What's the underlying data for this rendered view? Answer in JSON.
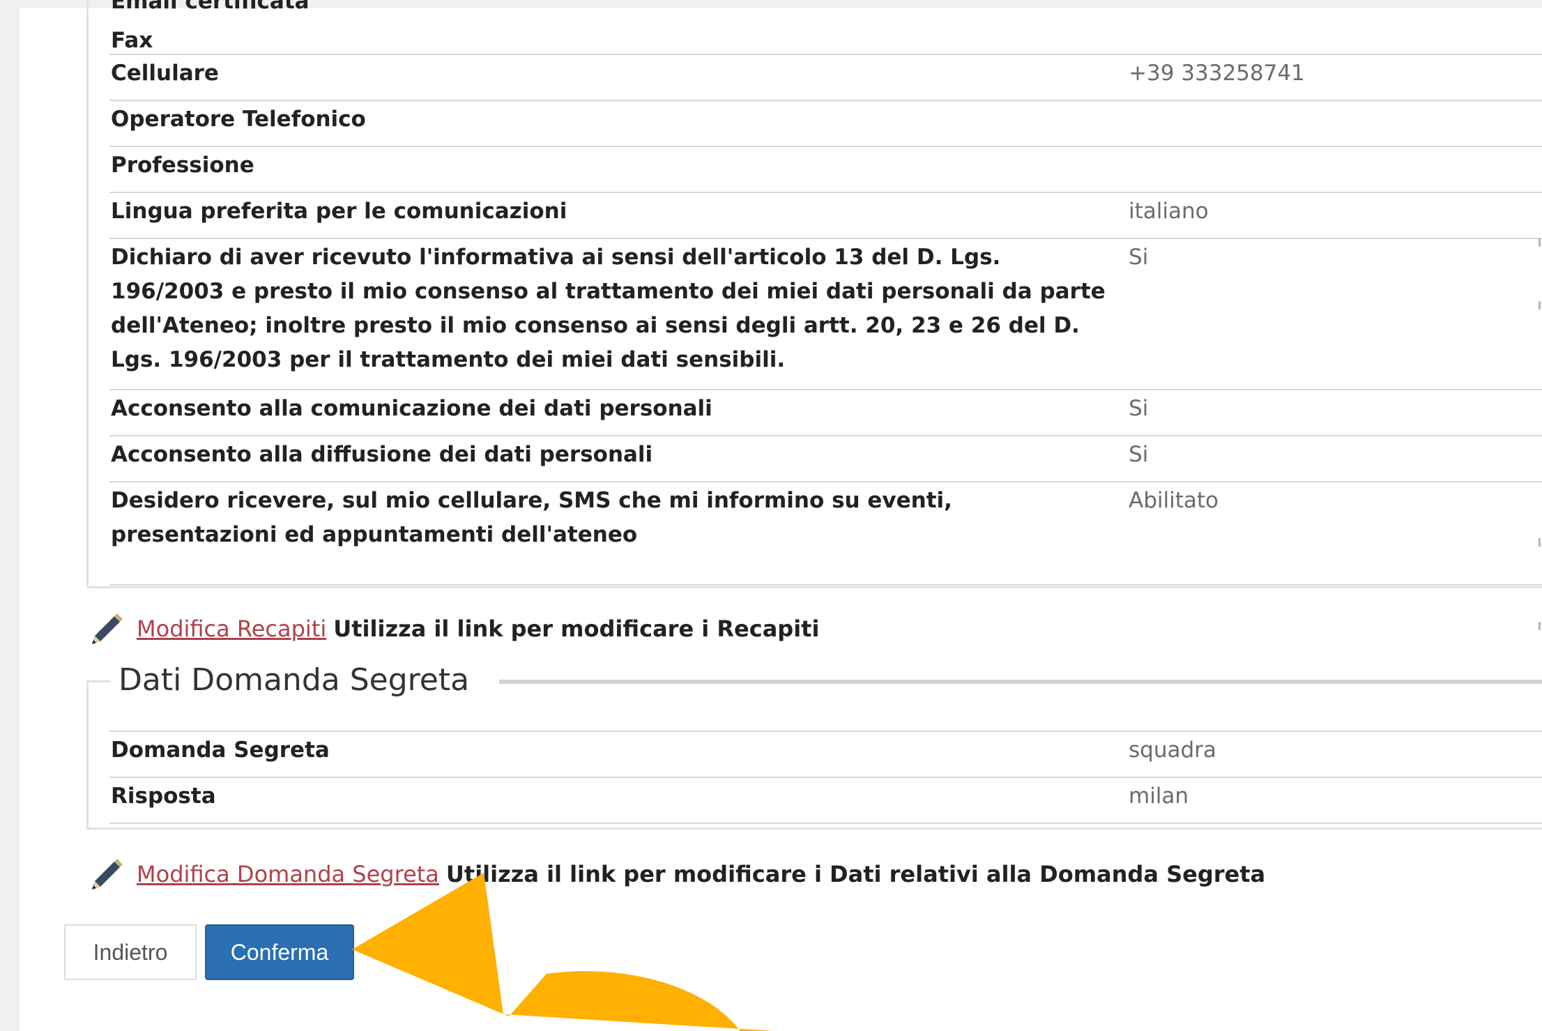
{
  "contacts": {
    "cut_label": "Email certificata",
    "rows": [
      {
        "label": "Fax",
        "value": ""
      },
      {
        "label": "Cellulare",
        "value": "+39 333258741"
      },
      {
        "label": "Operatore Telefonico",
        "value": ""
      },
      {
        "label": "Professione",
        "value": ""
      },
      {
        "label": "Lingua preferita per le comunicazioni",
        "value": "italiano"
      },
      {
        "label": "Dichiaro di aver ricevuto l'informativa ai sensi dell'articolo 13 del D. Lgs. 196/2003 e presto il mio consenso al trattamento dei miei dati personali da parte dell'Ateneo; inoltre presto il mio consenso ai sensi degli artt. 20, 23 e 26 del D. Lgs. 196/2003 per il trattamento dei miei dati sensibili.",
        "value": "Si"
      },
      {
        "label": "Acconsento alla comunicazione dei dati personali",
        "value": "Si"
      },
      {
        "label": "Acconsento alla diffusione dei dati personali",
        "value": "Si"
      },
      {
        "label": "Desidero ricevere, sul mio cellulare, SMS che mi informino su eventi, presentazioni ed appuntamenti dell'ateneo",
        "value": "Abilitato"
      }
    ],
    "edit_link": "Modifica Recapiti",
    "edit_text": "Utilizza il link per modificare i Recapiti",
    "edit_icon": "pencil-icon"
  },
  "secret": {
    "title": "Dati Domanda Segreta",
    "rows": [
      {
        "label": "Domanda Segreta",
        "value": "squadra"
      },
      {
        "label": "Risposta",
        "value": "milan"
      }
    ],
    "edit_link": "Modifica Domanda Segreta",
    "edit_text": "Utilizza il link per modificare i Dati relativi alla Domanda Segreta",
    "edit_icon": "pencil-icon"
  },
  "actions": {
    "back_label": "Indietro",
    "confirm_label": "Conferma"
  },
  "colors": {
    "link": "#b0414a",
    "primary_button": "#2b6fb3",
    "annotation_arrow": "#ffb000"
  }
}
